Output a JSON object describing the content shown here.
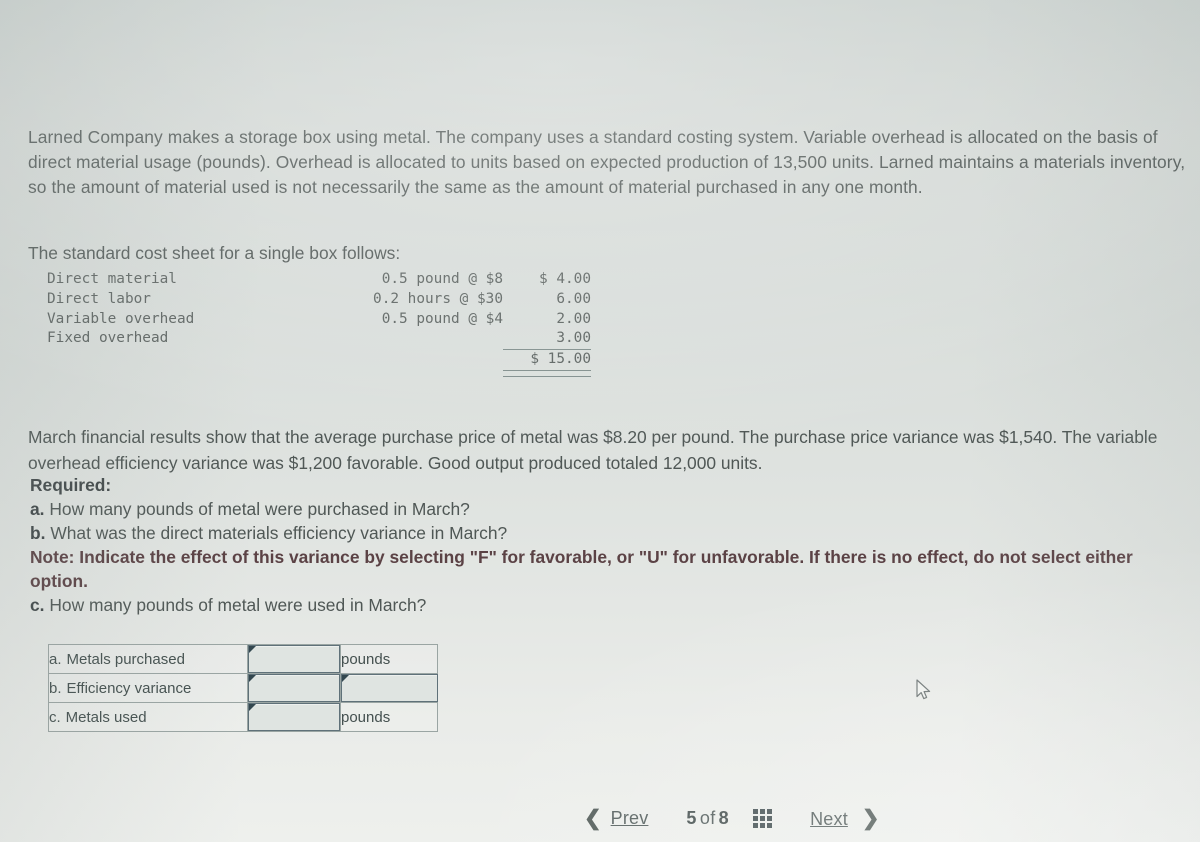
{
  "intro": {
    "paragraph": "Larned Company makes a storage box using metal. The company uses a standard costing system. Variable overhead is allocated on the basis of direct material usage (pounds). Overhead is allocated to units based on expected production of 13,500 units. Larned maintains a materials inventory, so the amount of material used is not necessarily the same as the amount of material purchased in any one month.",
    "sheet_lead": "The standard cost sheet for a single box follows:"
  },
  "cost_sheet": {
    "rows": [
      {
        "label": "Direct material",
        "spec": "0.5 pound @ $8",
        "amount": "$ 4.00"
      },
      {
        "label": "Direct labor",
        "spec": "0.2 hours @ $30",
        "amount": "6.00"
      },
      {
        "label": "Variable overhead",
        "spec": "0.5 pound @ $4",
        "amount": "2.00"
      },
      {
        "label": "Fixed overhead",
        "spec": "",
        "amount": "3.00"
      }
    ],
    "total": "$ 15.00"
  },
  "march": {
    "paragraph": "March financial results show that the average purchase price of metal was $8.20 per pound. The purchase price variance was $1,540. The variable overhead efficiency variance was $1,200 favorable. Good output produced totaled 12,000 units."
  },
  "required": {
    "heading": "Required:",
    "a_letter": "a.",
    "a_text": "How many pounds of metal were purchased in March?",
    "b_letter": "b.",
    "b_text": "What was the direct materials efficiency variance in March?",
    "note": "Note: Indicate the effect of this variance by selecting \"F\" for favorable, or \"U\" for unfavorable. If there is no effect, do not select either option.",
    "c_letter": "c.",
    "c_text": "How many pounds of metal were used in March?"
  },
  "answer_table": {
    "rows": [
      {
        "letter": "a.",
        "label": "Metals purchased",
        "value": "",
        "unit": "pounds",
        "unit_is_input": false
      },
      {
        "letter": "b.",
        "label": "Efficiency variance",
        "value": "",
        "unit": "",
        "unit_is_input": true
      },
      {
        "letter": "c.",
        "label": "Metals used",
        "value": "",
        "unit": "pounds",
        "unit_is_input": false
      }
    ]
  },
  "nav": {
    "prev_label": "Prev",
    "prev_icon": "chevron-left-icon",
    "page_current": "5",
    "page_of": "of",
    "page_total": "8",
    "grid_icon": "grid-view-icon",
    "next_label": "Next",
    "next_icon": "chevron-right-icon"
  },
  "cursor": {
    "icon": "mouse-pointer-icon"
  },
  "colors": {
    "background": "#d7dcd9",
    "text": "#4f5755",
    "note_text": "#5b4245",
    "field_border": "#5f7179",
    "table_border": "#9aa5a3"
  }
}
